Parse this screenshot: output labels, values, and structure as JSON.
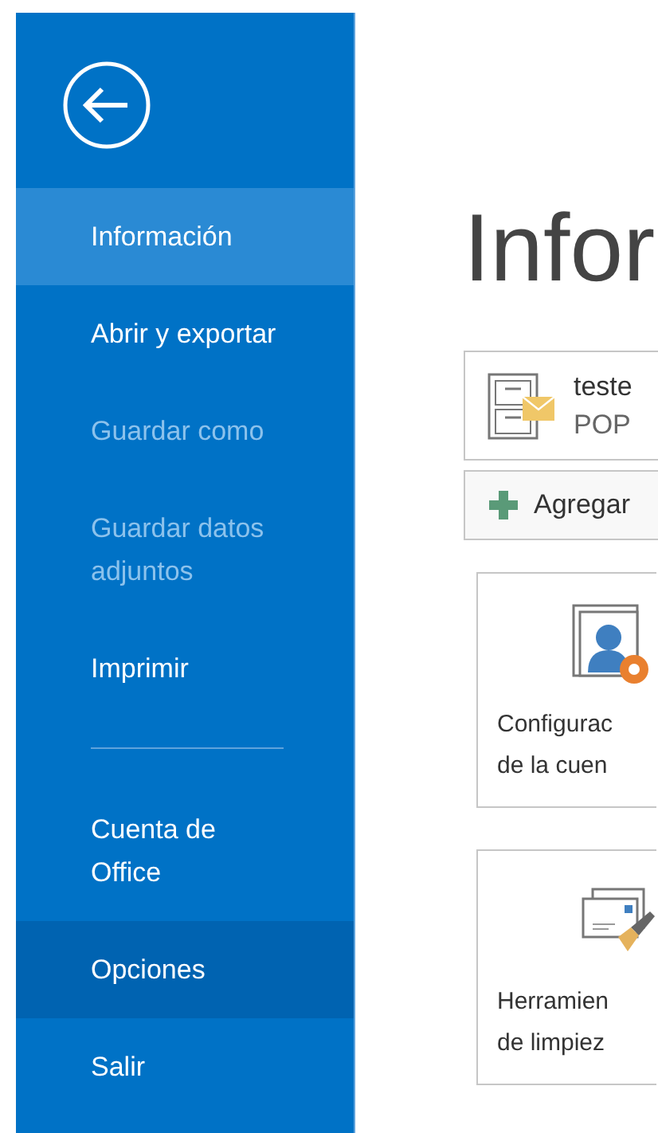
{
  "sidebar": {
    "items": [
      {
        "label": "Información",
        "selected": true,
        "disabled": false,
        "hovered": false
      },
      {
        "label": "Abrir y exportar",
        "selected": false,
        "disabled": false,
        "hovered": false
      },
      {
        "label": "Guardar como",
        "selected": false,
        "disabled": true,
        "hovered": false
      },
      {
        "label": "Guardar datos adjuntos",
        "selected": false,
        "disabled": true,
        "hovered": false
      },
      {
        "label": "Imprimir",
        "selected": false,
        "disabled": false,
        "hovered": false
      },
      {
        "kind": "separator"
      },
      {
        "label": "Cuenta de Office",
        "selected": false,
        "disabled": false,
        "hovered": false
      },
      {
        "label": "Opciones",
        "selected": false,
        "disabled": false,
        "hovered": true
      },
      {
        "label": "Salir",
        "selected": false,
        "disabled": false,
        "hovered": false
      }
    ]
  },
  "main": {
    "title": "Infor",
    "account": {
      "name": "teste",
      "type": "POP"
    },
    "add_button": "Agregar",
    "tiles": [
      {
        "kind": "account-settings",
        "lines": [
          "Configurac",
          "de la cuen"
        ]
      },
      {
        "kind": "cleanup",
        "lines": [
          "Herramien",
          "de limpiez"
        ]
      }
    ]
  }
}
